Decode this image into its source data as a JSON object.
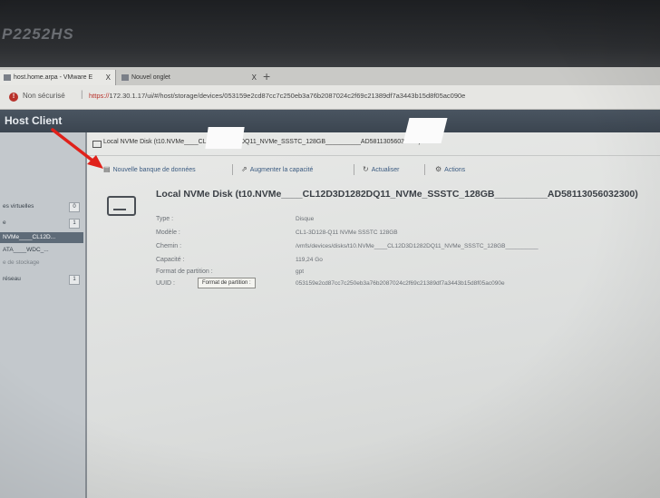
{
  "monitor": {
    "label": "P2252HS"
  },
  "browser": {
    "tabs": [
      {
        "label": "host.home.arpa - VMware E",
        "close": "X"
      },
      {
        "label": "Nouvel onglet",
        "close": "X"
      }
    ],
    "new_tab": "+",
    "security_warning": "Non sécurisé",
    "url_scheme": "https://",
    "url_rest": "172.30.1.17/ui/#/host/storage/devices/053159e2cd87cc7c250eb3a76b2087024c2f69c21389df7a3443b15d8f05ac090e"
  },
  "app": {
    "title": "Host Client"
  },
  "sidebar": {
    "vms": {
      "label": "es virtuelles",
      "count": "0"
    },
    "storage": {
      "label": "e",
      "count": "1"
    },
    "device1": "NVMe____CL12D...",
    "device2": "ATA____WDC_...",
    "datastore": "e de stockage",
    "network": {
      "label": "réseau",
      "count": "1"
    }
  },
  "breadcrumb": "Local NVMe Disk (t10.NVMe____CL12D3D1282DQ11_NVMe_SSSTC_128GB__________AD58113056032300)",
  "toolbar": {
    "new_datastore": "Nouvelle banque de données",
    "increase_capacity": "Augmenter la capacité",
    "refresh": "Actualiser",
    "actions": "Actions"
  },
  "disk": {
    "title": "Local NVMe Disk (t10.NVMe____CL12D3D1282DQ11_NVMe_SSSTC_128GB__________AD58113056032300)",
    "properties": {
      "type": {
        "label": "Type :",
        "value": "Disque"
      },
      "model": {
        "label": "Modèle :",
        "value": "CL1-3D128-Q11 NVMe SSSTC 128GB"
      },
      "path": {
        "label": "Chemin :",
        "value": "/vmfs/devices/disks/t10.NVMe____CL12D3D1282DQ11_NVMe_SSSTC_128GB__________"
      },
      "capacity": {
        "label": "Capacité :",
        "value": "119,24 Go"
      },
      "format": {
        "label": "Format de partition :",
        "value": "gpt"
      },
      "uuid": {
        "label": "UUID :",
        "value": "053159e2cd87cc7c250eb3a76b2087024c2f69c21389df7a3443b15d8f05ac090e"
      }
    }
  },
  "tooltip": "Format de partition :",
  "colors": {
    "annotation_arrow": "#e0211a",
    "header": "#3b4550",
    "link": "#3a5a80"
  }
}
